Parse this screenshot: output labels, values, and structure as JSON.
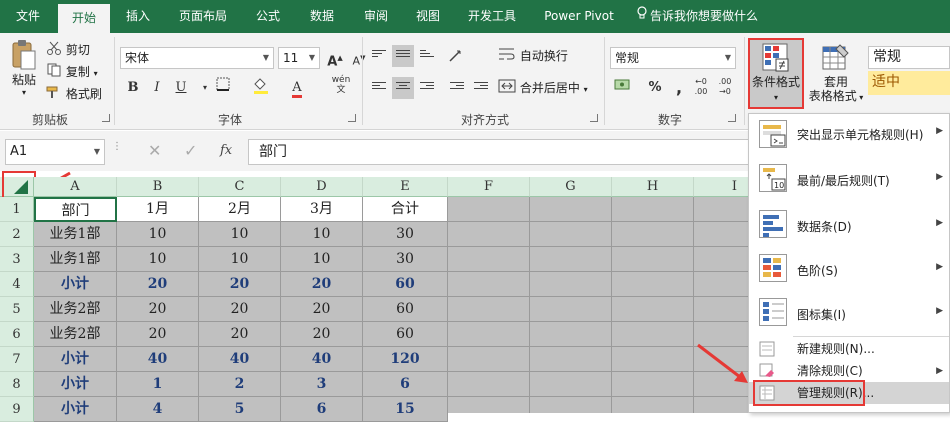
{
  "tabs": [
    "文件",
    "开始",
    "插入",
    "页面布局",
    "公式",
    "数据",
    "审阅",
    "视图",
    "开发工具",
    "Power Pivot"
  ],
  "tellme": "告诉我你想要做什么",
  "clipboard": {
    "paste": "粘贴",
    "cut": "剪切",
    "copy": "复制",
    "painter": "格式刷",
    "group": "剪贴板"
  },
  "font": {
    "name": "宋体",
    "size": "11",
    "group": "字体",
    "bold": "B",
    "italic": "I",
    "underline": "U",
    "grow": "A",
    "shrink": "A",
    "fontcolor": "A",
    "phonetic": "wén"
  },
  "align": {
    "wrap": "自动换行",
    "merge": "合并后居中",
    "group": "对齐方式"
  },
  "number": {
    "format": "常规",
    "group": "数字",
    "percent": "%",
    "comma": ","
  },
  "cond": {
    "line1": "条件格式",
    "table1": "套用",
    "table2": "表格格式"
  },
  "styles": {
    "normal": "常规",
    "neutral": "适中"
  },
  "namebox": "A1",
  "formula": "部门",
  "fx": "fx",
  "columns": [
    "A",
    "B",
    "C",
    "D",
    "E",
    "F",
    "G",
    "H",
    "I"
  ],
  "rows": [
    "1",
    "2",
    "3",
    "4",
    "5",
    "6",
    "7",
    "8",
    "9"
  ],
  "cells": [
    [
      "部门",
      "1月",
      "2月",
      "3月",
      "合计"
    ],
    [
      "业务1部",
      "10",
      "10",
      "10",
      "30"
    ],
    [
      "业务1部",
      "10",
      "10",
      "10",
      "30"
    ],
    [
      "小计",
      "20",
      "20",
      "20",
      "60"
    ],
    [
      "业务2部",
      "20",
      "20",
      "20",
      "60"
    ],
    [
      "业务2部",
      "20",
      "20",
      "20",
      "60"
    ],
    [
      "小计",
      "40",
      "40",
      "40",
      "120"
    ],
    [
      "小计",
      "1",
      "2",
      "3",
      "6"
    ],
    [
      "小计",
      "4",
      "5",
      "6",
      "15"
    ]
  ],
  "menu": {
    "highlight": "突出显示单元格规则(H)",
    "topbottom": "最前/最后规则(T)",
    "databar": "数据条(D)",
    "colorscale": "色阶(S)",
    "iconset": "图标集(I)",
    "newrule": "新建规则(N)...",
    "clearrule": "清除规则(C)",
    "managerule": "管理规则(R)..."
  },
  "colors": {
    "accent": "#217346",
    "highlight": "#e53935"
  }
}
